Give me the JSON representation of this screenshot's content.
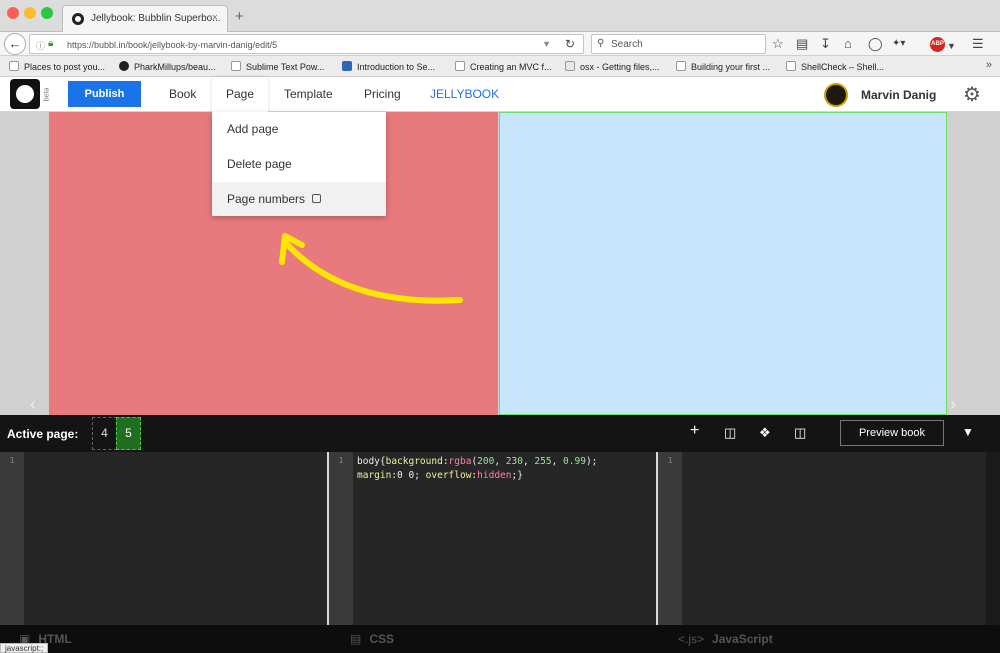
{
  "browser": {
    "tab_title": "Jellybook: Bubblin Superbo...",
    "tab_close": "×",
    "new_tab": "+",
    "url": "https://bubbl.in/book/jellybook-by-marvin-danig/edit/5",
    "search_placeholder": "Search",
    "adblock_label": "ABP",
    "bookmarks": [
      "Places to post you...",
      "PharkMillups/beau...",
      "Sublime Text Pow...",
      "Introduction to Se...",
      "Creating an MVC f...",
      "osx - Getting files,...",
      "Building your first ...",
      "ShellCheck – Shell..."
    ],
    "bookmarks_more": "»",
    "status_url": "javascript:;"
  },
  "app": {
    "logo_badge": "beta",
    "publish_label": "Publish",
    "menu": [
      "Book",
      "Page",
      "Template",
      "Pricing",
      "JELLYBOOK"
    ],
    "user_name": "Marvin Danig"
  },
  "page_menu": {
    "items": [
      "Add page",
      "Delete page",
      "Page numbers"
    ]
  },
  "stage": {
    "left_page_color": "#e87a7e",
    "right_page_color": "#c8e6fb",
    "annotation_color": "#ffe600"
  },
  "editor": {
    "active_page_label": "Active page:",
    "pages": [
      "4",
      "5"
    ],
    "current_page": "5",
    "preview_label": "Preview book",
    "css_code": {
      "line1": {
        "selector": "body{",
        "prop": "background",
        "colon": ":",
        "fn": "rgba",
        "open": "(",
        "n1": "200",
        "sep1": ", ",
        "n2": "230",
        "sep2": ", ",
        "n3": "255",
        "sep3": ", ",
        "n4": "0.99",
        "close": ");"
      },
      "line2": {
        "prop1": "margin",
        "val1": ":0 0; ",
        "prop2": "overflow",
        "colon": ":",
        "val2": "hidden",
        "close": ";}"
      }
    },
    "line_number": "1",
    "tabs": [
      {
        "icon": "html5-icon",
        "label": "HTML"
      },
      {
        "icon": "css3-icon",
        "label": "CSS"
      },
      {
        "icon": "js-icon",
        "prefix": "<.js>",
        "label": "JavaScript"
      }
    ]
  }
}
